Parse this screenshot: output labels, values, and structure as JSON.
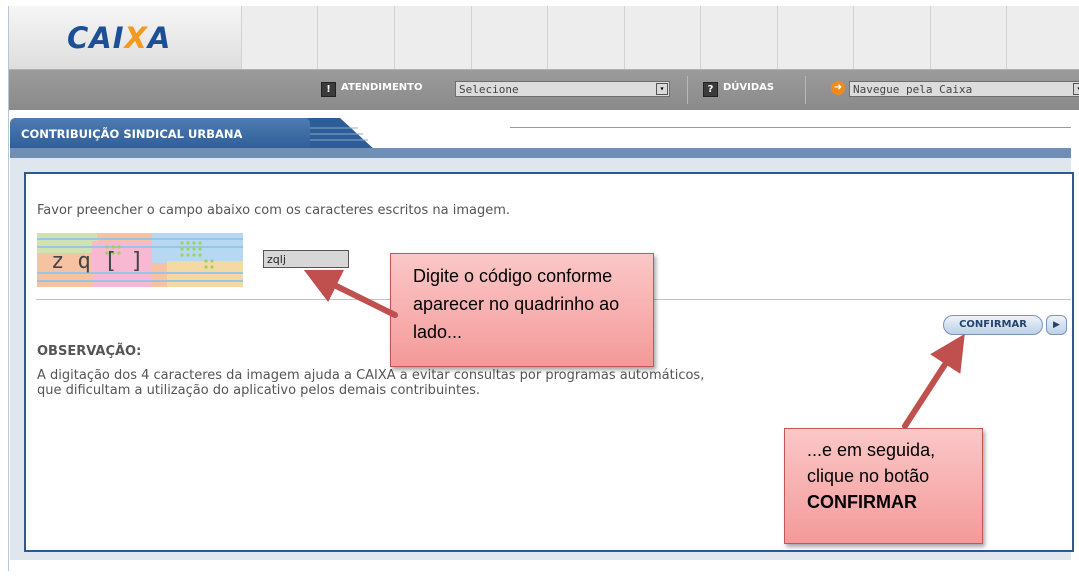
{
  "header": {
    "logo_text_1": "CAI",
    "logo_text_x": "X",
    "logo_text_2": "A",
    "brand_blue": "#1c4f94",
    "brand_orange": "#f39a1e"
  },
  "nav": {
    "atendimento_badge": "!",
    "atendimento_label": "ATENDIMENTO",
    "atendimento_select": "Selecione",
    "duvidas_badge": "?",
    "duvidas_label": "DÚVIDAS",
    "navegue_select": "Navegue pela Caixa",
    "select_arrow": "▾",
    "go_icon": "➜"
  },
  "tab": {
    "label": "CONTRIBUIÇÃO SINDICAL URBANA"
  },
  "form": {
    "instruction": "Favor preencher o campo abaixo com os caracteres escritos na imagem.",
    "captcha_chars": "z q [ ]",
    "captcha_value": "zqlj",
    "confirm_label": "CONFIRMAR",
    "confirm_arrow": "▶"
  },
  "observation": {
    "title": "OBSERVAÇÃO:",
    "line1": "A digitação dos 4 caracteres da imagem ajuda a CAIXA a evitar consultas por programas automáticos,",
    "line2": "que dificultam a utilização do aplicativo pelos demais contribuintes."
  },
  "annotations": {
    "callout1": "Digite o código conforme aparecer no quadrinho ao lado...",
    "callout2_line1": "...e em seguida,",
    "callout2_line2": "clique no botão",
    "callout2_bold": "CONFIRMAR",
    "callout_color": "#f49a9a",
    "arrow_color": "#c0504d"
  }
}
